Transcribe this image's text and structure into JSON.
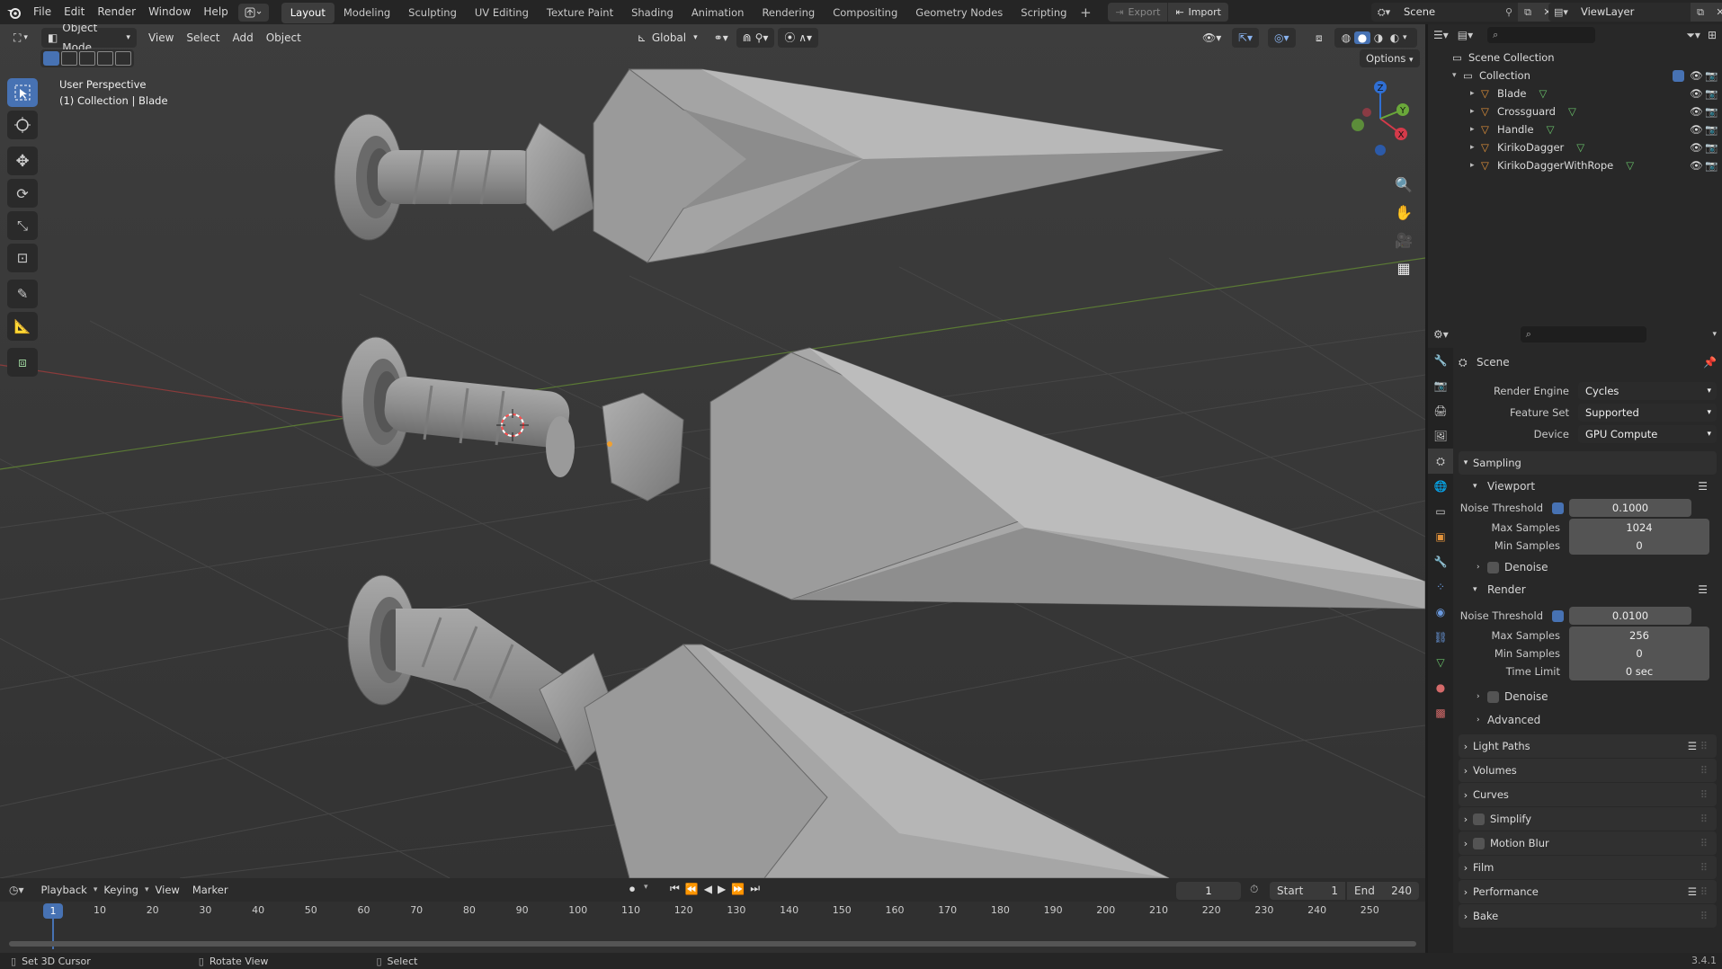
{
  "topbar": {
    "menus": [
      "File",
      "Edit",
      "Render",
      "Window",
      "Help"
    ],
    "workspaces": [
      "Layout",
      "Modeling",
      "Sculpting",
      "UV Editing",
      "Texture Paint",
      "Shading",
      "Animation",
      "Rendering",
      "Compositing",
      "Geometry Nodes",
      "Scripting"
    ],
    "active_workspace": "Layout",
    "export_label": "Export",
    "import_label": "Import",
    "scene_name": "Scene",
    "view_layer": "ViewLayer"
  },
  "viewport_header": {
    "mode": "Object Mode",
    "menus": [
      "View",
      "Select",
      "Add",
      "Object"
    ],
    "orientation": "Global",
    "options_label": "Options"
  },
  "viewport": {
    "perspective_label": "User Perspective",
    "collection_label": "(1) Collection | Blade",
    "axis_labels": {
      "x": "X",
      "y": "Y",
      "z": "Z"
    }
  },
  "outliner": {
    "search_placeholder": "",
    "root": "Scene Collection",
    "collection": "Collection",
    "objects": [
      "Blade",
      "Crossguard",
      "Handle",
      "KirikoDagger",
      "KirikoDaggerWithRope"
    ]
  },
  "properties": {
    "context_title": "Scene",
    "render_engine_label": "Render Engine",
    "render_engine": "Cycles",
    "feature_set_label": "Feature Set",
    "feature_set": "Supported",
    "device_label": "Device",
    "device": "GPU Compute",
    "sampling_label": "Sampling",
    "viewport_label": "Viewport",
    "noise_threshold_label": "Noise Threshold",
    "viewport_noise_threshold": "0.1000",
    "max_samples_label": "Max Samples",
    "viewport_max_samples": "1024",
    "min_samples_label": "Min Samples",
    "viewport_min_samples": "0",
    "denoise_label": "Denoise",
    "render_label": "Render",
    "render_noise_threshold": "0.0100",
    "render_max_samples": "256",
    "render_min_samples": "0",
    "time_limit_label": "Time Limit",
    "time_limit": "0 sec",
    "advanced_label": "Advanced",
    "panels": [
      "Light Paths",
      "Volumes",
      "Curves",
      "Simplify",
      "Motion Blur",
      "Film",
      "Performance",
      "Bake"
    ]
  },
  "timeline": {
    "menus": [
      "Playback",
      "Keying",
      "View",
      "Marker"
    ],
    "current_frame": "1",
    "start_label": "Start",
    "start": "1",
    "end_label": "End",
    "end": "240",
    "ruler": [
      "10",
      "20",
      "30",
      "40",
      "50",
      "60",
      "70",
      "80",
      "90",
      "100",
      "110",
      "120",
      "130",
      "140",
      "150",
      "160",
      "170",
      "180",
      "190",
      "200",
      "210",
      "220",
      "230",
      "240",
      "250"
    ],
    "playhead": "1"
  },
  "statusbar": {
    "left": "Set 3D Cursor",
    "middle": "Rotate View",
    "right": "Select",
    "version": "3.4.1"
  },
  "colors": {
    "accent": "#4772b3",
    "object_orange": "#e0913a",
    "mesh_green": "#69c16a"
  }
}
